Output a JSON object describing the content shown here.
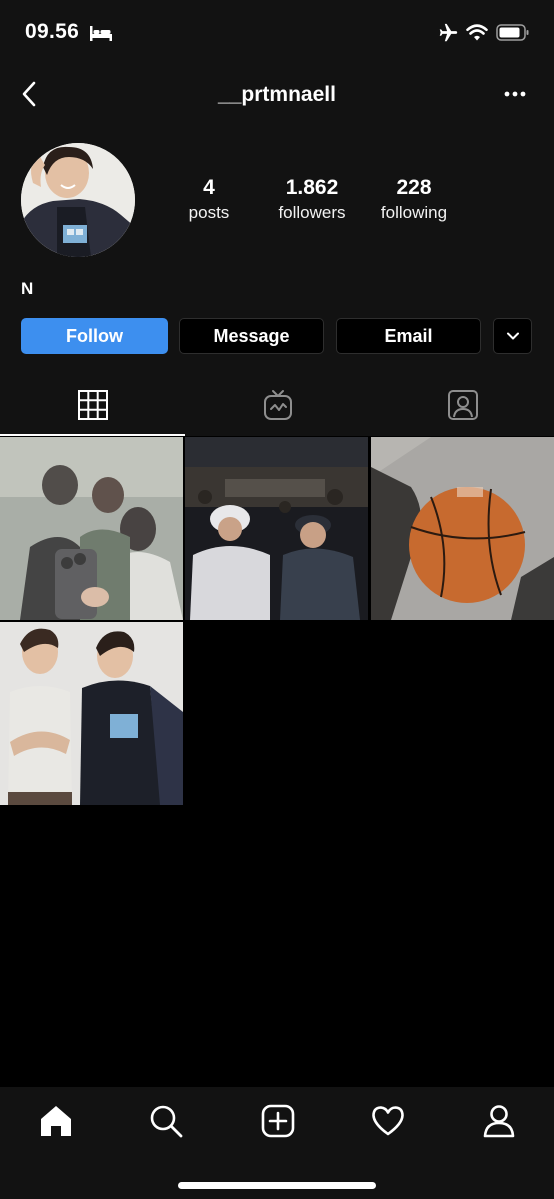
{
  "status_bar": {
    "time": "09.56",
    "icons": [
      "bed-icon",
      "airplane-icon",
      "wifi-icon",
      "battery-icon"
    ]
  },
  "header": {
    "username": "__prtmnaell",
    "back_icon": "chevron-left-icon",
    "more_icon": "ellipsis-icon"
  },
  "profile": {
    "display_name": "N",
    "stats": {
      "posts": {
        "value": "4",
        "label": "posts"
      },
      "followers": {
        "value": "1.862",
        "label": "followers"
      },
      "following": {
        "value": "228",
        "label": "following"
      }
    }
  },
  "actions": {
    "follow": "Follow",
    "message": "Message",
    "email": "Email",
    "more_icon": "chevron-down-icon"
  },
  "tabs": [
    {
      "name": "grid",
      "icon": "grid-icon",
      "active": true
    },
    {
      "name": "igtv",
      "icon": "igtv-icon",
      "active": false
    },
    {
      "name": "tagged",
      "icon": "tagged-icon",
      "active": false
    }
  ],
  "posts": [
    {
      "subject": "group mirror selfie"
    },
    {
      "subject": "crowd in arena"
    },
    {
      "subject": "hand holding basketball"
    },
    {
      "subject": "two friends posing"
    }
  ],
  "bottom_nav": [
    "home-icon",
    "search-icon",
    "new-post-icon",
    "heart-icon",
    "profile-icon"
  ],
  "colors": {
    "follow_button": "#3d8fef",
    "background": "#000000",
    "header_background": "#121212"
  }
}
